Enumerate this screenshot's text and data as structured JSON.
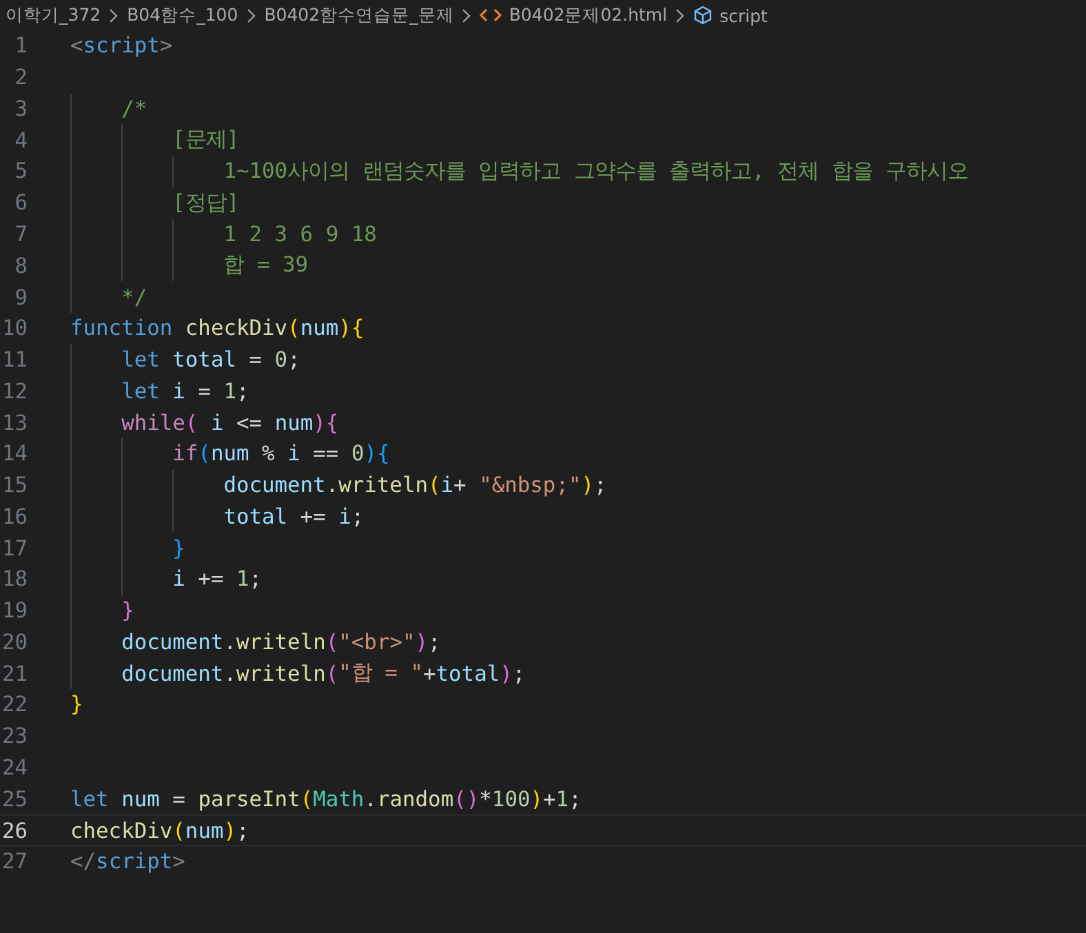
{
  "breadcrumb": [
    {
      "text": "이학기_372",
      "kind": "folder"
    },
    {
      "text": "B04함수_100",
      "kind": "folder"
    },
    {
      "text": "B0402함수연습문_문제",
      "kind": "folder"
    },
    {
      "text": "B0402문제02.html",
      "kind": "file"
    },
    {
      "text": "script",
      "kind": "symbol"
    }
  ],
  "lines": [
    {
      "number": "1",
      "selected": false,
      "tokens": [
        {
          "kind": "tagpunct",
          "text": "<"
        },
        {
          "kind": "tag",
          "text": "script"
        },
        {
          "kind": "tagpunct",
          "text": ">"
        }
      ]
    },
    {
      "number": "2",
      "selected": false
    },
    {
      "number": "3",
      "selected": false,
      "tokens": [
        {
          "kind": "comment",
          "text": "    /*"
        }
      ]
    },
    {
      "number": "4",
      "selected": false,
      "tokens": [
        {
          "kind": "comment",
          "text": "        [문제]"
        }
      ]
    },
    {
      "number": "5",
      "selected": false,
      "tokens": [
        {
          "kind": "comment",
          "text": "            1~100사이의 랜덤숫자를 입력하고 그약수를 출력하고, 전체 합을 구하시오"
        }
      ]
    },
    {
      "number": "6",
      "selected": false,
      "tokens": [
        {
          "kind": "comment",
          "text": "        [정답]"
        }
      ]
    },
    {
      "number": "7",
      "selected": false,
      "tokens": [
        {
          "kind": "comment",
          "text": "            1 2 3 6 9 18"
        }
      ]
    },
    {
      "number": "8",
      "selected": false,
      "tokens": [
        {
          "kind": "comment",
          "text": "            합 = 39"
        }
      ]
    },
    {
      "number": "9",
      "selected": false,
      "tokens": [
        {
          "kind": "comment",
          "text": "    */"
        }
      ]
    },
    {
      "number": "10",
      "selected": false,
      "tokens": [
        {
          "kind": "keyword",
          "text": "function"
        },
        {
          "kind": "function",
          "text": " checkDiv"
        },
        {
          "kind": "bracket1",
          "text": "("
        },
        {
          "kind": "variable",
          "text": "num"
        },
        {
          "kind": "bracket1",
          "text": ")"
        },
        {
          "kind": "bracket1",
          "text": "{"
        }
      ]
    },
    {
      "number": "11",
      "selected": false,
      "tokens": [
        {
          "kind": "keyword",
          "text": "    let"
        },
        {
          "kind": "variable",
          "text": " total"
        },
        {
          "kind": "plain",
          "text": " = "
        },
        {
          "kind": "number",
          "text": "0"
        },
        {
          "kind": "plain",
          "text": ";"
        }
      ]
    },
    {
      "number": "12",
      "selected": false,
      "tokens": [
        {
          "kind": "keyword",
          "text": "    let"
        },
        {
          "kind": "variable",
          "text": " i"
        },
        {
          "kind": "plain",
          "text": " = "
        },
        {
          "kind": "number",
          "text": "1"
        },
        {
          "kind": "plain",
          "text": ";"
        }
      ]
    },
    {
      "number": "13",
      "selected": false,
      "tokens": [
        {
          "kind": "control",
          "text": "    while"
        },
        {
          "kind": "bracket2",
          "text": "("
        },
        {
          "kind": "variable",
          "text": " i"
        },
        {
          "kind": "plain",
          "text": " <= "
        },
        {
          "kind": "variable",
          "text": "num"
        },
        {
          "kind": "bracket2",
          "text": ")"
        },
        {
          "kind": "bracket2",
          "text": "{"
        }
      ]
    },
    {
      "number": "14",
      "selected": false,
      "tokens": [
        {
          "kind": "control",
          "text": "        if"
        },
        {
          "kind": "bracket3",
          "text": "("
        },
        {
          "kind": "variable",
          "text": "num"
        },
        {
          "kind": "plain",
          "text": " % "
        },
        {
          "kind": "variable",
          "text": "i"
        },
        {
          "kind": "plain",
          "text": " == "
        },
        {
          "kind": "number",
          "text": "0"
        },
        {
          "kind": "bracket3",
          "text": ")"
        },
        {
          "kind": "bracket3",
          "text": "{"
        }
      ]
    },
    {
      "number": "15",
      "selected": false,
      "tokens": [
        {
          "kind": "variable",
          "text": "            document"
        },
        {
          "kind": "plain",
          "text": "."
        },
        {
          "kind": "function",
          "text": "writeln"
        },
        {
          "kind": "bracket1",
          "text": "("
        },
        {
          "kind": "variable",
          "text": "i"
        },
        {
          "kind": "plain",
          "text": "+"
        },
        {
          "kind": "string",
          "text": " \"&nbsp;\""
        },
        {
          "kind": "bracket1",
          "text": ")"
        },
        {
          "kind": "plain",
          "text": ";"
        }
      ]
    },
    {
      "number": "16",
      "selected": false,
      "tokens": [
        {
          "kind": "variable",
          "text": "            total"
        },
        {
          "kind": "plain",
          "text": " += "
        },
        {
          "kind": "variable",
          "text": "i"
        },
        {
          "kind": "plain",
          "text": ";"
        }
      ]
    },
    {
      "number": "17",
      "selected": false,
      "tokens": [
        {
          "kind": "bracket3",
          "text": "        }"
        }
      ]
    },
    {
      "number": "18",
      "selected": false,
      "tokens": [
        {
          "kind": "variable",
          "text": "        i"
        },
        {
          "kind": "plain",
          "text": " += "
        },
        {
          "kind": "number",
          "text": "1"
        },
        {
          "kind": "plain",
          "text": ";"
        }
      ]
    },
    {
      "number": "19",
      "selected": false,
      "tokens": [
        {
          "kind": "bracket2",
          "text": "    }"
        }
      ]
    },
    {
      "number": "20",
      "selected": false,
      "tokens": [
        {
          "kind": "variable",
          "text": "    document"
        },
        {
          "kind": "plain",
          "text": "."
        },
        {
          "kind": "function",
          "text": "writeln"
        },
        {
          "kind": "bracket2",
          "text": "("
        },
        {
          "kind": "string",
          "text": "\"<br>\""
        },
        {
          "kind": "bracket2",
          "text": ")"
        },
        {
          "kind": "plain",
          "text": ";"
        }
      ]
    },
    {
      "number": "21",
      "selected": false,
      "tokens": [
        {
          "kind": "variable",
          "text": "    document"
        },
        {
          "kind": "plain",
          "text": "."
        },
        {
          "kind": "function",
          "text": "writeln"
        },
        {
          "kind": "bracket2",
          "text": "("
        },
        {
          "kind": "string",
          "text": "\"합 = \""
        },
        {
          "kind": "plain",
          "text": "+"
        },
        {
          "kind": "variable",
          "text": "total"
        },
        {
          "kind": "bracket2",
          "text": ")"
        },
        {
          "kind": "plain",
          "text": ";"
        }
      ]
    },
    {
      "number": "22",
      "selected": false,
      "tokens": [
        {
          "kind": "bracket1",
          "text": "}"
        }
      ]
    },
    {
      "number": "23",
      "selected": false
    },
    {
      "number": "24",
      "selected": false
    },
    {
      "number": "25",
      "selected": false,
      "tokens": [
        {
          "kind": "keyword",
          "text": "let"
        },
        {
          "kind": "variable",
          "text": " num"
        },
        {
          "kind": "plain",
          "text": " = "
        },
        {
          "kind": "function",
          "text": "parseInt"
        },
        {
          "kind": "bracket1",
          "text": "("
        },
        {
          "kind": "class",
          "text": "Math"
        },
        {
          "kind": "plain",
          "text": "."
        },
        {
          "kind": "function",
          "text": "random"
        },
        {
          "kind": "bracket2",
          "text": "()"
        },
        {
          "kind": "plain",
          "text": "*"
        },
        {
          "kind": "number",
          "text": "100"
        },
        {
          "kind": "bracket1",
          "text": ")"
        },
        {
          "kind": "plain",
          "text": "+"
        },
        {
          "kind": "number",
          "text": "1"
        },
        {
          "kind": "plain",
          "text": ";"
        }
      ]
    },
    {
      "number": "26",
      "selected": true,
      "tokens": [
        {
          "kind": "function",
          "text": "checkDiv"
        },
        {
          "kind": "bracket1",
          "text": "("
        },
        {
          "kind": "variable",
          "text": "num"
        },
        {
          "kind": "bracket1",
          "text": ")"
        },
        {
          "kind": "plain",
          "text": ";"
        }
      ]
    },
    {
      "number": "27",
      "selected": false,
      "tokens": [
        {
          "kind": "tagpunct",
          "text": "</"
        },
        {
          "kind": "tag",
          "text": "script"
        },
        {
          "kind": "tagpunct",
          "text": ">"
        }
      ]
    }
  ]
}
